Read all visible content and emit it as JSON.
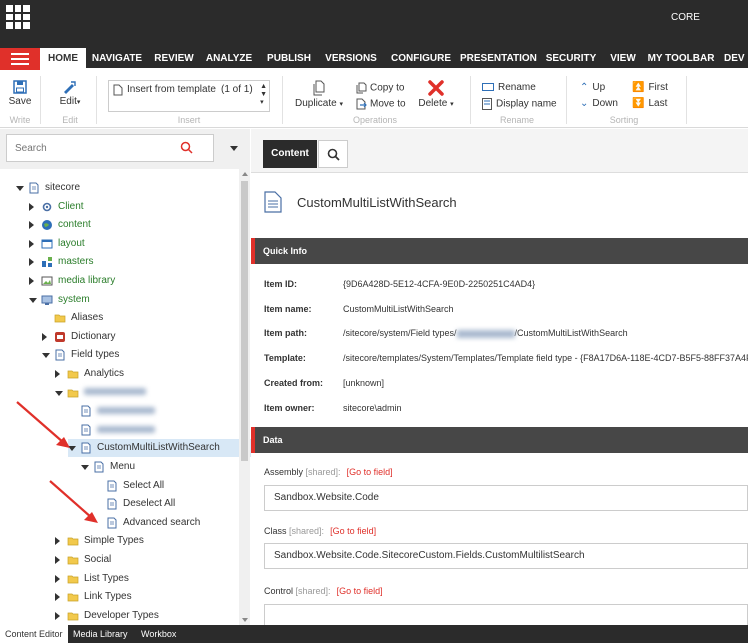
{
  "app": {
    "environment": "CORE"
  },
  "ribbon": {
    "tabs": [
      {
        "label": "HOME",
        "active": true
      },
      {
        "label": "NAVIGATE"
      },
      {
        "label": "REVIEW"
      },
      {
        "label": "ANALYZE"
      },
      {
        "label": "PUBLISH"
      },
      {
        "label": "VERSIONS"
      },
      {
        "label": "CONFIGURE"
      },
      {
        "label": "PRESENTATION"
      },
      {
        "label": "SECURITY"
      },
      {
        "label": "VIEW"
      },
      {
        "label": "MY TOOLBAR"
      },
      {
        "label": "DEV"
      }
    ],
    "save": {
      "label": "Save",
      "group": "Write"
    },
    "edit": {
      "label": "Edit",
      "group": "Edit"
    },
    "insert": {
      "item": "Insert from template",
      "count": "(1 of 1)",
      "group": "Insert"
    },
    "operations": {
      "duplicate": "Duplicate",
      "copy_to": "Copy to",
      "move_to": "Move to",
      "delete": "Delete",
      "group": "Operations"
    },
    "rename": {
      "rename": "Rename",
      "display_name": "Display name",
      "group": "Rename"
    },
    "sorting": {
      "up": "Up",
      "down": "Down",
      "first": "First",
      "last": "Last",
      "group": "Sorting"
    }
  },
  "search": {
    "placeholder": "Search"
  },
  "tree": [
    {
      "label": "sitecore",
      "depth": 0,
      "expanded": true
    },
    {
      "label": "Client",
      "depth": 1,
      "green": true
    },
    {
      "label": "content",
      "depth": 1,
      "green": true
    },
    {
      "label": "layout",
      "depth": 1,
      "green": true
    },
    {
      "label": "masters",
      "depth": 1,
      "green": true
    },
    {
      "label": "media library",
      "depth": 1,
      "green": true
    },
    {
      "label": "system",
      "depth": 1,
      "green": true,
      "expanded": true
    },
    {
      "label": "Aliases",
      "depth": 2
    },
    {
      "label": "Dictionary",
      "depth": 2
    },
    {
      "label": "Field types",
      "depth": 2,
      "expanded": true
    },
    {
      "label": "Analytics",
      "depth": 3
    },
    {
      "label": "",
      "depth": 3,
      "expanded": true
    },
    {
      "label": "",
      "depth": 4
    },
    {
      "label": "",
      "depth": 4
    },
    {
      "label": "CustomMultiListWithSearch",
      "depth": 4,
      "expanded": true,
      "selected": true
    },
    {
      "label": "Menu",
      "depth": 5,
      "expanded": true
    },
    {
      "label": "Select All",
      "depth": 6
    },
    {
      "label": "Deselect All",
      "depth": 6
    },
    {
      "label": "Advanced search",
      "depth": 6
    },
    {
      "label": "Simple Types",
      "depth": 3
    },
    {
      "label": "Social",
      "depth": 3
    },
    {
      "label": "List Types",
      "depth": 3
    },
    {
      "label": "Link Types",
      "depth": 3
    },
    {
      "label": "Developer Types",
      "depth": 3
    }
  ],
  "content": {
    "tab_label": "Content",
    "title": "CustomMultiListWithSearch",
    "quick_info": {
      "heading": "Quick Info",
      "rows": [
        {
          "label": "Item ID:",
          "value": "{9D6A428D-5E12-4CFA-9E0D-2250251C4AD4}"
        },
        {
          "label": "Item name:",
          "value": "CustomMultiListWithSearch"
        },
        {
          "label": "Item path:",
          "value": "/sitecore/system/Field types/",
          "value_suffix": "/CustomMultiListWithSearch"
        },
        {
          "label": "Template:",
          "value": "/sitecore/templates/System/Templates/Template field type - {F8A17D6A-118E-4CD7-B5F5-88FF37A4F23"
        },
        {
          "label": "Created from:",
          "value": "[unknown]"
        },
        {
          "label": "Item owner:",
          "value": "sitecore\\admin"
        }
      ]
    },
    "data": {
      "heading": "Data",
      "fields": [
        {
          "label": "Assembly",
          "shared": "[shared]:",
          "goto": "[Go to field]",
          "value": "Sandbox.Website.Code"
        },
        {
          "label": "Class",
          "shared": "[shared]:",
          "goto": "[Go to field]",
          "value": "Sandbox.Website.Code.SitecoreCustom.Fields.CustomMultilistSearch"
        },
        {
          "label": "Control",
          "shared": "[shared]:",
          "goto": "[Go to field]",
          "value": ""
        }
      ]
    }
  },
  "bottom_tabs": [
    {
      "label": "Content Editor",
      "active": true
    },
    {
      "label": "Media Library"
    },
    {
      "label": "Workbox"
    }
  ],
  "colors": {
    "accent": "#e0302a",
    "dark": "#2b2b2b",
    "tree_green": "#2a7d2a",
    "selection": "#d8e8f6"
  }
}
